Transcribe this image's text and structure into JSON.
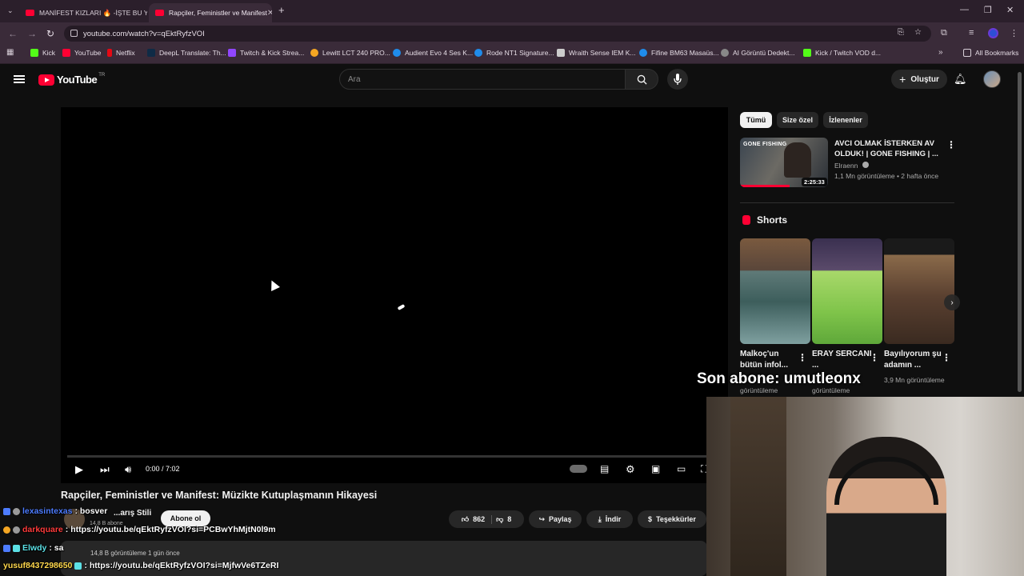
{
  "browser": {
    "tabs": [
      {
        "label": "MANİFEST KIZLARI 🔥 -İŞTE BU Y",
        "active": false
      },
      {
        "label": "Rapçiler, Feministler ve Manifest",
        "active": true
      }
    ],
    "new_tab": "+",
    "url": "youtube.com/watch?v=qEktRyfzVOI",
    "bookmarks": [
      {
        "label": "Kick",
        "color": "#53fc18"
      },
      {
        "label": "YouTube",
        "color": "#ff0033"
      },
      {
        "label": "Netflix",
        "color": "#e50914"
      },
      {
        "label": "DeepL Translate: Th...",
        "color": "#0f2b46"
      },
      {
        "label": "Twitch & Kick Strea...",
        "color": "#9146ff"
      },
      {
        "label": "Lewitt LCT 240 PRO...",
        "color": "#f5a623"
      },
      {
        "label": "Audient Evo 4 Ses K...",
        "color": "#1f8ceb"
      },
      {
        "label": "Rode NT1 Signature...",
        "color": "#1f8ceb"
      },
      {
        "label": "Wraith Sense IEM K...",
        "color": "#cccccc"
      },
      {
        "label": "Fifine BM63 Masaüs...",
        "color": "#1f8ceb"
      },
      {
        "label": "AI Görüntü Dedekt...",
        "color": "#888888"
      },
      {
        "label": "Kick / Twitch VOD d...",
        "color": "#53fc18"
      }
    ],
    "all_bookmarks": "All Bookmarks"
  },
  "youtube": {
    "logo_text": "YouTube",
    "logo_region": "TR",
    "search_placeholder": "Ara",
    "create_label": "Oluştur"
  },
  "player": {
    "time": "0:00 / 7:02",
    "progress": 0
  },
  "video": {
    "title": "Rapçiler, Feministler ve Manifest: Müzikte Kutuplaşmanın Hikayesi",
    "channel": "...arış Stili",
    "subscribers": "14,8 B abone",
    "subscribe_label": "Abone ol",
    "likes": "862",
    "dislikes": "8",
    "share_label": "Paylaş",
    "download_label": "İndir",
    "thanks_label": "Teşekkürler",
    "desc_meta": "14,8 B görüntüleme  1 gün önce"
  },
  "sidebar": {
    "chips": [
      {
        "label": "Tümü",
        "active": true
      },
      {
        "label": "Size özel",
        "active": false
      },
      {
        "label": "İzlenenler",
        "active": false
      }
    ],
    "recommended": {
      "thumb_label": "GONE FISHING",
      "duration": "2:25:33",
      "title": "AVCI OLMAK İSTERKEN AV OLDUK! | GONE FISHING | ...",
      "channel": "Elraenn",
      "meta": "1,1 Mn görüntüleme • 2 hafta önce"
    },
    "shorts_heading": "Shorts",
    "shorts": [
      {
        "title": "Malkoç'un bütün infol...",
        "views": "görüntüleme"
      },
      {
        "title": "ERAY SERCANI ...",
        "views": "görüntüleme"
      },
      {
        "title": "Bayılıyorum şu adamın ...",
        "views": "3,9 Mn görüntüleme"
      }
    ]
  },
  "overlay": {
    "last_sub": "Son abone: umutleonx",
    "chat": [
      {
        "user": "lexasintexas",
        "msg": ": bosver",
        "color": "#4d7cff"
      },
      {
        "user": "darkquare",
        "msg": ": https://youtu.be/qEktRyfzVOI?si=PCBwYhMjtN0l9m",
        "color": "#ff3b3b"
      },
      {
        "user": "Elwdy",
        "msg": ": sa",
        "color": "#5ce1e6"
      },
      {
        "user": "yusuf8437298650",
        "msg": ": https://youtu.be/qEktRyfzVOI?si=MjfwVe6TZeRI",
        "color": "#ffd84d"
      }
    ]
  }
}
